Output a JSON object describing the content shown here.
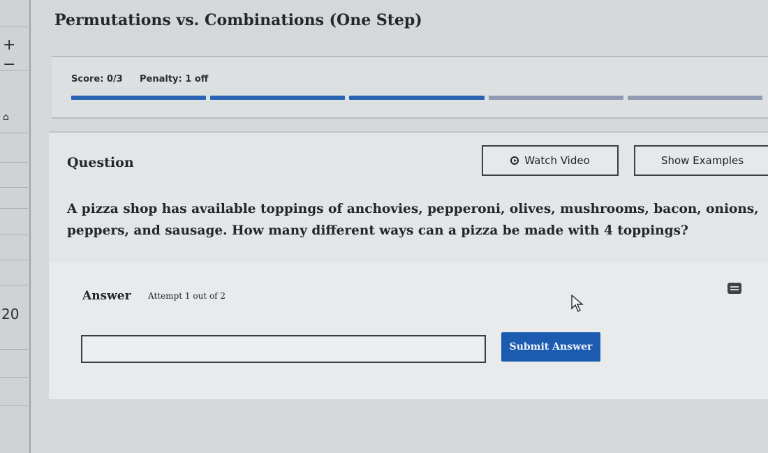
{
  "left_strip": {
    "zoom_in_icon": "plus-icon",
    "zoom_out_icon": "minus-icon",
    "number": "20"
  },
  "page": {
    "title": "Permutations vs. Combinations (One Step)"
  },
  "score": {
    "score_text": "Score: 0/3",
    "penalty_text": "Penalty: 1 off",
    "progress_segments": [
      "filled",
      "filled",
      "filled",
      "empty",
      "empty"
    ],
    "colors": {
      "filled": "#2a62b4",
      "empty": "#8f9ab0"
    }
  },
  "question": {
    "label": "Question",
    "watch_video_label": "Watch Video",
    "watch_video_icon": "play-circle-icon",
    "show_examples_label": "Show Examples",
    "text": "A pizza shop has available toppings of anchovies, pepperoni, olives, mushrooms, bacon, onions, peppers, and sausage. How many different ways can a pizza be made with 4 toppings?"
  },
  "answer": {
    "label": "Answer",
    "attempt_text": "Attempt 1 out of 2",
    "input_value": "",
    "keyboard_icon": "keyboard-icon",
    "submit_label": "Submit Answer",
    "submit_color": "#1c5cb0"
  }
}
